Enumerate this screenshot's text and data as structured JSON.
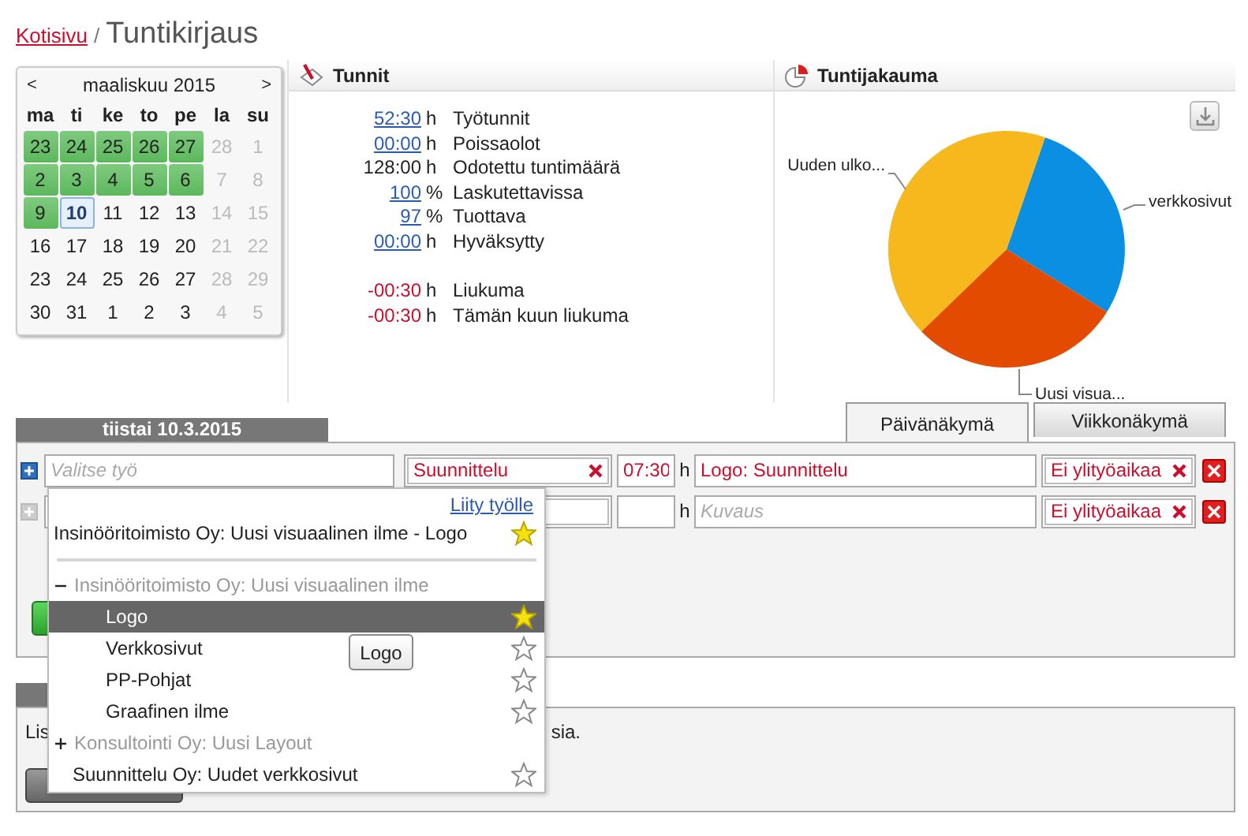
{
  "breadcrumb": {
    "home": "Kotisivu",
    "separator": "/",
    "title": "Tuntikirjaus"
  },
  "calendar": {
    "prev": "<",
    "month": "maaliskuu 2015",
    "next": ">",
    "weekdays": [
      "ma",
      "ti",
      "ke",
      "to",
      "pe",
      "la",
      "su"
    ],
    "weeks": [
      [
        {
          "day": "23",
          "kind": "logged"
        },
        {
          "day": "24",
          "kind": "logged"
        },
        {
          "day": "25",
          "kind": "logged"
        },
        {
          "day": "26",
          "kind": "logged"
        },
        {
          "day": "27",
          "kind": "logged"
        },
        {
          "day": "28",
          "kind": "muted"
        },
        {
          "day": "1",
          "kind": "muted"
        }
      ],
      [
        {
          "day": "2",
          "kind": "logged"
        },
        {
          "day": "3",
          "kind": "logged"
        },
        {
          "day": "4",
          "kind": "logged"
        },
        {
          "day": "5",
          "kind": "logged"
        },
        {
          "day": "6",
          "kind": "logged"
        },
        {
          "day": "7",
          "kind": "muted"
        },
        {
          "day": "8",
          "kind": "muted"
        }
      ],
      [
        {
          "day": "9",
          "kind": "logged"
        },
        {
          "day": "10",
          "kind": "today"
        },
        {
          "day": "11",
          "kind": "plain"
        },
        {
          "day": "12",
          "kind": "plain"
        },
        {
          "day": "13",
          "kind": "plain"
        },
        {
          "day": "14",
          "kind": "muted"
        },
        {
          "day": "15",
          "kind": "muted"
        }
      ],
      [
        {
          "day": "16",
          "kind": "plain"
        },
        {
          "day": "17",
          "kind": "plain"
        },
        {
          "day": "18",
          "kind": "plain"
        },
        {
          "day": "19",
          "kind": "plain"
        },
        {
          "day": "20",
          "kind": "plain"
        },
        {
          "day": "21",
          "kind": "muted"
        },
        {
          "day": "22",
          "kind": "muted"
        }
      ],
      [
        {
          "day": "23",
          "kind": "plain"
        },
        {
          "day": "24",
          "kind": "plain"
        },
        {
          "day": "25",
          "kind": "plain"
        },
        {
          "day": "26",
          "kind": "plain"
        },
        {
          "day": "27",
          "kind": "plain"
        },
        {
          "day": "28",
          "kind": "muted"
        },
        {
          "day": "29",
          "kind": "muted"
        }
      ],
      [
        {
          "day": "30",
          "kind": "plain"
        },
        {
          "day": "31",
          "kind": "plain"
        },
        {
          "day": "1",
          "kind": "plain"
        },
        {
          "day": "2",
          "kind": "plain"
        },
        {
          "day": "3",
          "kind": "plain"
        },
        {
          "day": "4",
          "kind": "muted"
        },
        {
          "day": "5",
          "kind": "muted"
        }
      ]
    ]
  },
  "hours": {
    "title": "Tunnit",
    "stats": [
      {
        "value": "52:30",
        "unit": "h",
        "label": "Työtunnit",
        "kind": "link"
      },
      {
        "value": "00:00",
        "unit": "h",
        "label": "Poissaolot",
        "kind": "link"
      },
      {
        "value": "128:00",
        "unit": "h",
        "label": "Odotettu tuntimäärä",
        "kind": "plain"
      },
      {
        "value": "100",
        "unit": "%",
        "label": "Laskutettavissa",
        "kind": "link"
      },
      {
        "value": "97",
        "unit": "%",
        "label": "Tuottava",
        "kind": "link"
      },
      {
        "value": "00:00",
        "unit": "h",
        "label": "Hyväksytty",
        "kind": "link"
      }
    ],
    "balance": [
      {
        "value": "-00:30",
        "unit": "h",
        "label": "Liukuma",
        "kind": "negative"
      },
      {
        "value": "-00:30",
        "unit": "h",
        "label": "Tämän kuun liukuma",
        "kind": "negative"
      }
    ]
  },
  "distribution": {
    "title": "Tuntijakauma",
    "slices": [
      {
        "label": "verkkosivut",
        "color": "#0a8fe3"
      },
      {
        "label": "Uusi visua...",
        "color": "#e34c00"
      },
      {
        "label": "Uuden ulko...",
        "color": "#f6b81c"
      }
    ]
  },
  "day_header": "tiistai 10.3.2015",
  "tabs": [
    {
      "label": "Päivänäkymä",
      "selected": true
    },
    {
      "label": "Viikkonäkymä",
      "selected": false
    }
  ],
  "entries": [
    {
      "disabled": false,
      "work_placeholder": "Valitse työ",
      "task": "Suunnittelu",
      "time": "07:30",
      "unit": "h",
      "description": "Logo: Suunnittelu",
      "overtime": "Ei ylityöaikaa"
    },
    {
      "disabled": true,
      "unit": "h",
      "description_placeholder": "Kuvaus",
      "overtime": "Ei ylityöaikaa"
    }
  ],
  "dropdown": {
    "link": "Liity työlle",
    "favorites": [
      {
        "label": "Insinööritoimisto Oy: Uusi visuaalinen ilme - Logo",
        "starred": true
      }
    ],
    "entries": [
      {
        "kind": "group",
        "label": "Insinööritoimisto Oy: Uusi visuaalinen ilme",
        "expanded": true,
        "children": [
          {
            "label": "Logo",
            "selected": true,
            "starred": true
          },
          {
            "label": "Verkkosivut",
            "selected": false,
            "starred": false
          },
          {
            "label": "PP-Pohjat",
            "selected": false,
            "starred": false
          },
          {
            "label": "Graafinen ilme",
            "selected": false,
            "starred": false
          }
        ]
      },
      {
        "kind": "group",
        "label": "Konsultointi Oy: Uusi Layout",
        "expanded": false
      },
      {
        "kind": "job",
        "label": "Suunnittelu Oy: Uudet verkkosivut",
        "starred": false
      }
    ]
  },
  "tooltip": "Logo",
  "notice": {
    "start": "Lis",
    "end": "sia."
  }
}
